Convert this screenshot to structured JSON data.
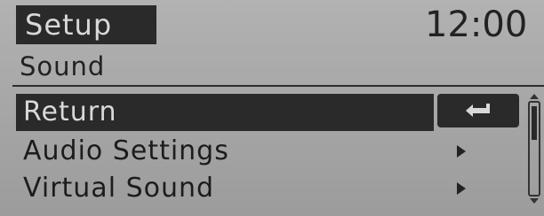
{
  "header": {
    "title": "Setup",
    "clock": "12:00"
  },
  "section": {
    "title": "Sound"
  },
  "menu": {
    "items": [
      {
        "label": "Return",
        "selected": true,
        "icon": "return-arrow-icon"
      },
      {
        "label": "Audio Settings",
        "icon": "chevron-right-icon"
      },
      {
        "label": "Virtual Sound",
        "icon": "chevron-right-icon"
      }
    ]
  },
  "colors": {
    "background": "#a6a6a6",
    "highlight": "#2a2a2a",
    "text": "#1f1f1f",
    "highlight_text": "#d9d9d9"
  }
}
